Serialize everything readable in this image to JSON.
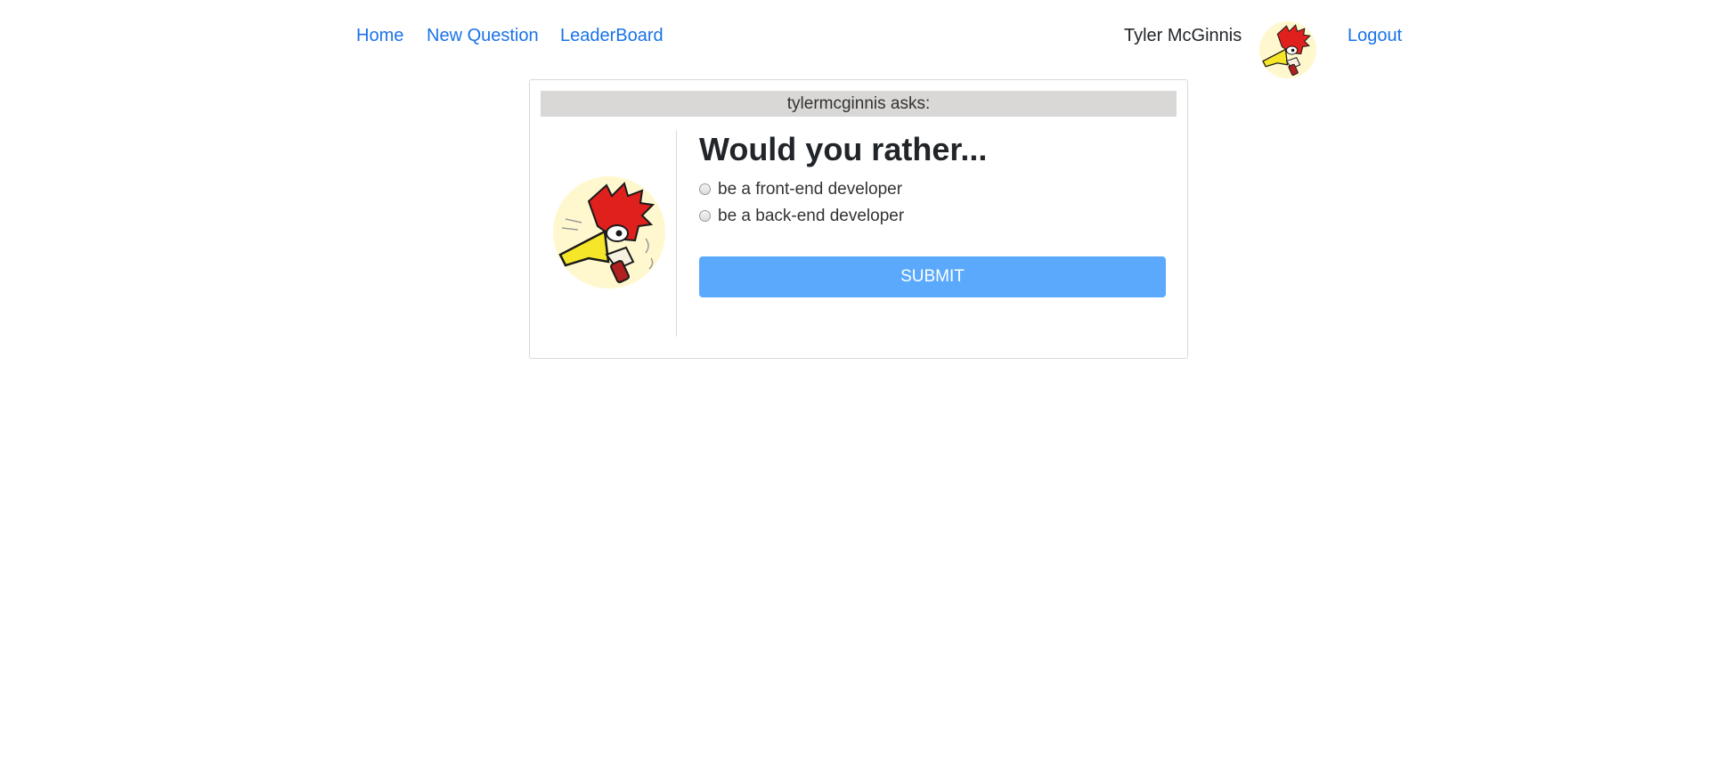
{
  "nav": {
    "home": "Home",
    "new_question": "New Question",
    "leaderboard": "LeaderBoard",
    "user_name": "Tyler McGinnis",
    "logout": "Logout",
    "link_color": "#1a73e8"
  },
  "question": {
    "author_label": "tylermcginnis asks:",
    "title": "Would you rather...",
    "options": [
      {
        "label": "be a front-end developer"
      },
      {
        "label": "be a back-end developer"
      }
    ],
    "submit_label": "SUBMIT",
    "submit_color": "#5aa9fc"
  },
  "icons": {
    "user_avatar": "woodpecker-avatar-icon"
  }
}
